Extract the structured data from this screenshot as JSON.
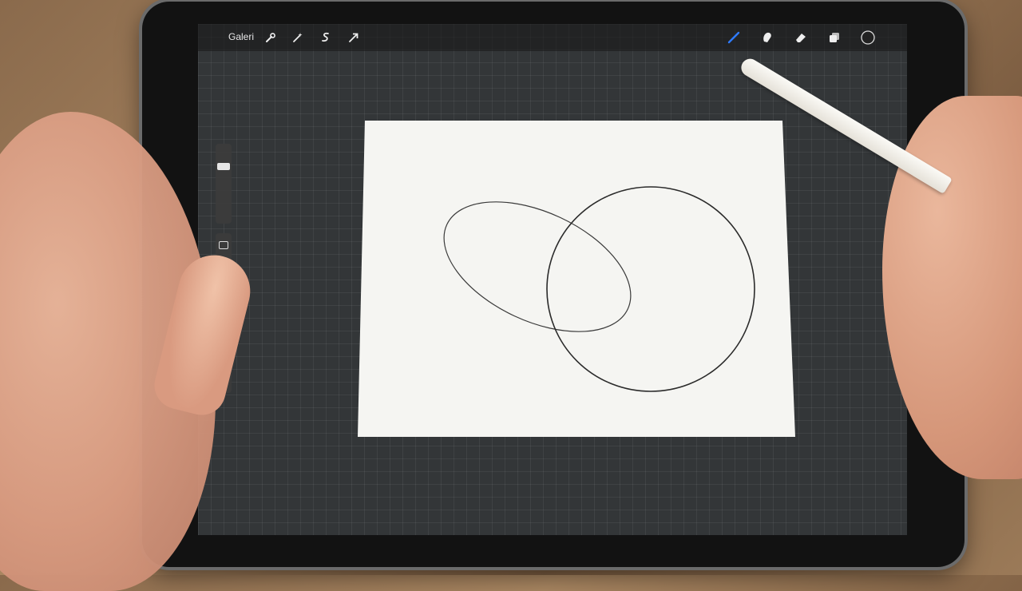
{
  "app": {
    "gallery_label": "Galeri"
  },
  "toolbar": {
    "left_tools": [
      {
        "icon": "wrench-icon"
      },
      {
        "icon": "magic-wand-icon"
      },
      {
        "icon": "selection-icon"
      },
      {
        "icon": "move-arrow-icon"
      }
    ],
    "right_tools": [
      {
        "icon": "brush-icon",
        "active": true
      },
      {
        "icon": "smudge-icon"
      },
      {
        "icon": "eraser-icon"
      },
      {
        "icon": "layers-icon"
      },
      {
        "icon": "color-swatch-icon"
      }
    ]
  },
  "colors": {
    "active_tool": "#2f7bff",
    "stroke": "#2a2a2a",
    "canvas_bg": "#f5f5f2"
  }
}
